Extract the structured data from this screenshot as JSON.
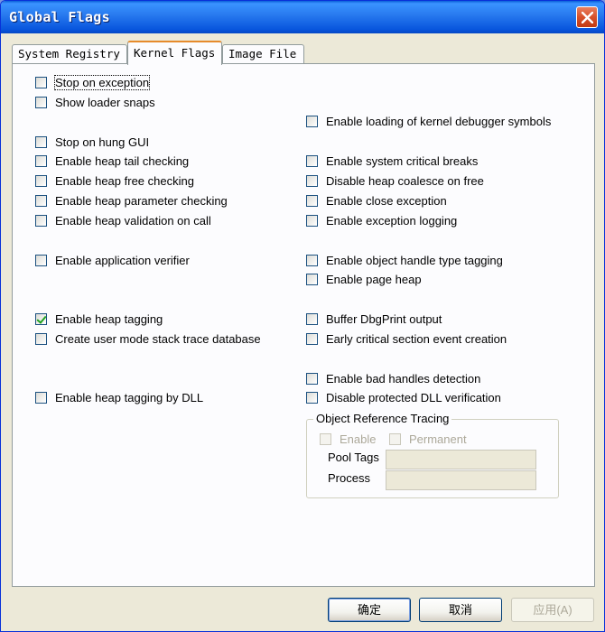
{
  "window": {
    "title": "Global Flags"
  },
  "tabs": [
    {
      "label": "System Registry",
      "active": false
    },
    {
      "label": "Kernel Flags",
      "active": true
    },
    {
      "label": "Image File",
      "active": false
    }
  ],
  "left_options": [
    {
      "label": "Stop on exception",
      "checked": false
    },
    {
      "label": "Show loader snaps",
      "checked": false
    },
    {
      "label": "Stop on hung GUI",
      "checked": false
    },
    {
      "label": "Enable heap tail checking",
      "checked": false
    },
    {
      "label": "Enable heap free checking",
      "checked": false
    },
    {
      "label": "Enable heap parameter checking",
      "checked": false
    },
    {
      "label": "Enable heap validation on call",
      "checked": false
    },
    {
      "label": "Enable application verifier",
      "checked": false
    },
    {
      "label": "Enable heap tagging",
      "checked": true
    },
    {
      "label": "Create user mode stack trace database",
      "checked": false
    },
    {
      "label": "Enable heap tagging by DLL",
      "checked": false
    }
  ],
  "right_options": [
    {
      "label": "Enable loading of kernel debugger symbols",
      "checked": false
    },
    {
      "label": "Enable system critical breaks",
      "checked": false
    },
    {
      "label": "Disable heap coalesce on free",
      "checked": false
    },
    {
      "label": "Enable close exception",
      "checked": false
    },
    {
      "label": "Enable exception logging",
      "checked": false
    },
    {
      "label": "Enable object handle type tagging",
      "checked": false
    },
    {
      "label": "Enable page heap",
      "checked": false
    },
    {
      "label": "Buffer DbgPrint output",
      "checked": false
    },
    {
      "label": "Early critical section event creation",
      "checked": false
    },
    {
      "label": "Enable bad handles detection",
      "checked": false
    },
    {
      "label": "Disable protected DLL verification",
      "checked": false
    }
  ],
  "object_reference_tracing": {
    "title": "Object Reference Tracing",
    "enable_label": "Enable",
    "permanent_label": "Permanent",
    "pool_tags_label": "Pool Tags",
    "pool_tags_value": "",
    "process_label": "Process",
    "process_value": ""
  },
  "buttons": {
    "ok": "确定",
    "cancel": "取消",
    "apply": "应用(A)"
  }
}
